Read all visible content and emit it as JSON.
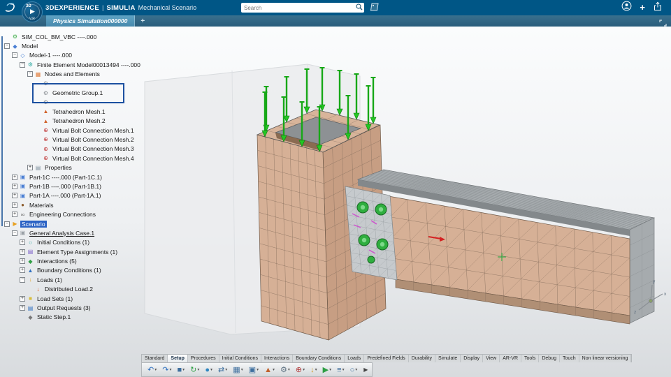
{
  "colors": {
    "accent": "#005686",
    "tab_active": "#5fa3c4",
    "selection_blue": "#2a62c4",
    "highlight_box": "#1c50a0",
    "load_green": "#1db51d",
    "mesh_tan": "#d6b096"
  },
  "topbar": {
    "brand": "3DEXPERIENCE",
    "separator": "|",
    "app": "SIMULIA",
    "module": "Mechanical Scenario",
    "search_placeholder": "Search",
    "add_glyph": "+"
  },
  "compass": {
    "top": "3D",
    "bottom": "V.R"
  },
  "tabbar": {
    "active_tab": "Physics Simulation000000",
    "new_tab_glyph": "+"
  },
  "viewport": {
    "compass_axes": {
      "x": "x",
      "y": "y",
      "z": "z"
    }
  },
  "icon_defs": {
    "root-gear": {
      "glyph": "⚙",
      "color": "#3fae49"
    },
    "model": {
      "glyph": "◆",
      "color": "#4a7fd4"
    },
    "model-sub": {
      "glyph": "◇",
      "color": "#4a7fd4"
    },
    "fem": {
      "glyph": "⚙",
      "color": "#2aa7a0"
    },
    "nodes": {
      "glyph": "▦",
      "color": "#e07b39"
    },
    "geo-group": {
      "glyph": "⚙",
      "color": "#8a8f94"
    },
    "tetra": {
      "glyph": "▲",
      "color": "#d2622a"
    },
    "bolt": {
      "glyph": "⊕",
      "color": "#c23b3b"
    },
    "properties": {
      "glyph": "▤",
      "color": "#7b8e9b"
    },
    "part": {
      "glyph": "▣",
      "color": "#4a7fd4"
    },
    "material": {
      "glyph": "●",
      "color": "#8a5a2a"
    },
    "connection": {
      "glyph": "∞",
      "color": "#666666"
    },
    "scenario": {
      "glyph": "▶",
      "color": "#e8a020"
    },
    "case": {
      "glyph": "▣",
      "color": "#9aa0a6"
    },
    "init-cond": {
      "glyph": "○",
      "color": "#2aa7a0"
    },
    "elem-type": {
      "glyph": "▤",
      "color": "#7b5ec9"
    },
    "interaction": {
      "glyph": "◆",
      "color": "#2f9e44"
    },
    "boundary": {
      "glyph": "▲",
      "color": "#2f6fc0"
    },
    "loads": {
      "glyph": "↓",
      "color": "#e0a020"
    },
    "dist-load": {
      "glyph": "↓",
      "color": "#e05a20"
    },
    "load-set": {
      "glyph": "■",
      "color": "#d8bc3a"
    },
    "output": {
      "glyph": "▤",
      "color": "#2f6fc0"
    },
    "step": {
      "glyph": "◆",
      "color": "#777777"
    }
  },
  "tree": {
    "items": [
      {
        "label": "SIM_COL_BM_VBC ----.000",
        "level": 0,
        "icon": "root-gear"
      },
      {
        "label": "Model",
        "level": 0,
        "icon": "model",
        "exp": "minus"
      },
      {
        "label": "Model-1 ----.000",
        "level": 1,
        "icon": "model-sub",
        "exp": "minus"
      },
      {
        "label": "Finite Element Model00013494 ----.000",
        "level": 2,
        "icon": "fem",
        "exp": "minus"
      },
      {
        "label": "Nodes and Elements",
        "level": 3,
        "icon": "nodes",
        "exp": "minus"
      },
      {
        "label": "",
        "level": 4,
        "icon": "geo-group",
        "obscured": true
      },
      {
        "label": "Geometric Group.1",
        "level": 4,
        "icon": "geo-group",
        "boxed": true
      },
      {
        "label": "",
        "level": 4,
        "icon": "geo-group",
        "obscured": true
      },
      {
        "label": "Tetrahedron Mesh.1",
        "level": 4,
        "icon": "tetra"
      },
      {
        "label": "Tetrahedron Mesh.2",
        "level": 4,
        "icon": "tetra"
      },
      {
        "label": "Virtual Bolt Connection Mesh.1",
        "level": 4,
        "icon": "bolt"
      },
      {
        "label": "Virtual Bolt Connection Mesh.2",
        "level": 4,
        "icon": "bolt"
      },
      {
        "label": "Virtual Bolt Connection Mesh.3",
        "level": 4,
        "icon": "bolt"
      },
      {
        "label": "Virtual Bolt Connection Mesh.4",
        "level": 4,
        "icon": "bolt"
      },
      {
        "label": "Properties",
        "level": 3,
        "icon": "properties",
        "exp": "plus"
      },
      {
        "label": "Part-1C ----.000 (Part-1C.1)",
        "level": 1,
        "icon": "part",
        "exp": "plus"
      },
      {
        "label": "Part-1B ----.000 (Part-1B.1)",
        "level": 1,
        "icon": "part",
        "exp": "plus"
      },
      {
        "label": "Part-1A ----.000 (Part-1A.1)",
        "level": 1,
        "icon": "part",
        "exp": "plus"
      },
      {
        "label": "Materials",
        "level": 1,
        "icon": "material",
        "exp": "plus"
      },
      {
        "label": "Engineering Connections",
        "level": 1,
        "icon": "connection",
        "exp": "plus"
      },
      {
        "label": "Scenario",
        "level": 0,
        "icon": "scenario",
        "exp": "minus",
        "selected": true
      },
      {
        "label": "General Analysis Case.1",
        "level": 1,
        "icon": "case",
        "exp": "minus",
        "underline": true
      },
      {
        "label": "Initial Conditions (1)",
        "level": 2,
        "icon": "init-cond",
        "exp": "plus"
      },
      {
        "label": "Element Type Assignments (1)",
        "level": 2,
        "icon": "elem-type",
        "exp": "plus"
      },
      {
        "label": "Interactions (5)",
        "level": 2,
        "icon": "interaction",
        "exp": "plus"
      },
      {
        "label": "Boundary Conditions (1)",
        "level": 2,
        "icon": "boundary",
        "exp": "plus"
      },
      {
        "label": "Loads (1)",
        "level": 2,
        "icon": "loads",
        "exp": "minus"
      },
      {
        "label": "Distributed Load.2",
        "level": 3,
        "icon": "dist-load"
      },
      {
        "label": "Load Sets (1)",
        "level": 2,
        "icon": "load-set",
        "exp": "plus"
      },
      {
        "label": "Output Requests (3)",
        "level": 2,
        "icon": "output",
        "exp": "plus"
      },
      {
        "label": "Static Step.1",
        "level": 2,
        "icon": "step"
      }
    ]
  },
  "ribbon": {
    "tabs": [
      "Standard",
      "Setup",
      "Procedures",
      "Initial Conditions",
      "Interactions",
      "Boundary Conditions",
      "Loads",
      "Predefined Fields",
      "Durability",
      "Simulate",
      "Display",
      "View",
      "AR-VR",
      "Tools",
      "Debug",
      "Touch",
      "Non linear versioning"
    ],
    "active_tab": "Setup"
  },
  "toolbar": {
    "overflow_glyph": "▶",
    "buttons": [
      {
        "name": "undo-button",
        "glyph": "↶",
        "color": "#2e6fbe",
        "dropdown": true
      },
      {
        "name": "redo-button",
        "glyph": "↷",
        "color": "#2e6fbe",
        "dropdown": true
      },
      {
        "name": "save-button",
        "glyph": "■",
        "color": "#3e6f9e",
        "dropdown": true
      },
      {
        "name": "refresh-button",
        "glyph": "↻",
        "color": "#2e9e44",
        "dropdown": true
      },
      {
        "name": "share-button",
        "glyph": "●",
        "color": "#2e86c1",
        "dropdown": true
      },
      {
        "name": "compare-button",
        "glyph": "⇄",
        "color": "#3e6f9e",
        "dropdown": true
      },
      {
        "name": "table-button",
        "glyph": "▦",
        "color": "#3e6f9e",
        "dropdown": true
      },
      {
        "name": "group-button",
        "glyph": "▣",
        "color": "#3e6f9e",
        "dropdown": true
      },
      {
        "name": "mesh-button",
        "glyph": "▲",
        "color": "#c2622e",
        "dropdown": true
      },
      {
        "name": "properties-button",
        "glyph": "⚙",
        "color": "#5a6e7e",
        "dropdown": true
      },
      {
        "name": "connections-button",
        "glyph": "⊕",
        "color": "#b23b3b",
        "dropdown": true
      },
      {
        "name": "loads-button",
        "glyph": "↓",
        "color": "#d09a20",
        "dropdown": true
      },
      {
        "name": "simulate-button",
        "glyph": "▶",
        "color": "#2e9e44",
        "dropdown": true
      },
      {
        "name": "fields-button",
        "glyph": "≡",
        "color": "#3e6f9e",
        "dropdown": true
      },
      {
        "name": "view-button",
        "glyph": "○",
        "color": "#3e6f9e",
        "dropdown": true
      }
    ]
  }
}
